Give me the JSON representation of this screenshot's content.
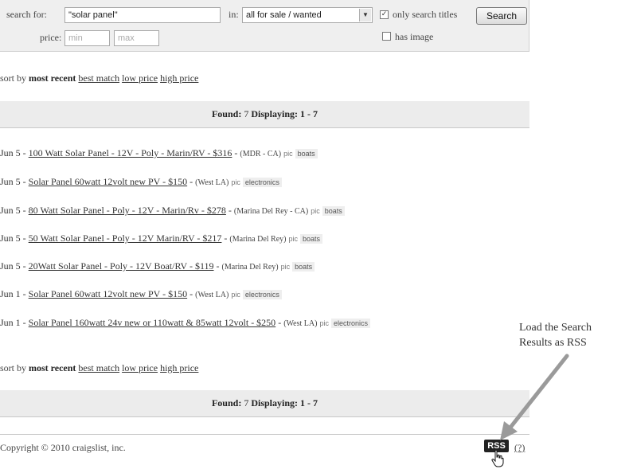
{
  "search": {
    "label": "search for:",
    "query": "\"solar panel\"",
    "in_label": "in:",
    "category": "all for sale / wanted",
    "only_titles_label": "only search titles",
    "only_titles_checked": true,
    "button_label": "Search",
    "price_label": "price:",
    "min_placeholder": "min",
    "max_placeholder": "max",
    "has_image_label": "has image",
    "has_image_checked": false
  },
  "sort": {
    "prefix": "sort by",
    "active": "most recent",
    "options": [
      "best match",
      "low price",
      "high price"
    ]
  },
  "found": {
    "label": "Found:",
    "count": "7",
    "displaying_label": "Displaying:",
    "range": "1 - 7"
  },
  "listings": [
    {
      "date": "Jun 5",
      "title": "100 Watt Solar Panel - 12V - Poly - Marin/RV - $316",
      "location": "(MDR - CA)",
      "pic": "pic",
      "category": "boats"
    },
    {
      "date": "Jun 5",
      "title": "Solar Panel 60watt 12volt new PV - $150",
      "location": "(West LA)",
      "pic": "pic",
      "category": "electronics"
    },
    {
      "date": "Jun 5",
      "title": "80 Watt Solar Panel - Poly - 12V - Marin/Rv - $278",
      "location": "(Marina Del Rey - CA)",
      "pic": "pic",
      "category": "boats"
    },
    {
      "date": "Jun 5",
      "title": "50 Watt Solar Panel - Poly - 12V Marin/RV - $217",
      "location": "(Marina Del Rey)",
      "pic": "pic",
      "category": "boats"
    },
    {
      "date": "Jun 5",
      "title": "20Watt Solar Panel - Poly - 12V Boat/RV - $119",
      "location": "(Marina Del Rey)",
      "pic": "pic",
      "category": "boats"
    },
    {
      "date": "Jun 1",
      "title": "Solar Panel 60watt 12volt new PV - $150",
      "location": "(West LA)",
      "pic": "pic",
      "category": "electronics"
    },
    {
      "date": "Jun 1",
      "title": "Solar Panel 160watt 24v new or 110watt & 85watt 12volt - $250",
      "location": "(West LA)",
      "pic": "pic",
      "category": "electronics"
    }
  ],
  "footer": {
    "copyright": "Copyright © 2010 craigslist, inc.",
    "rss_label": "RSS",
    "help_label": "(?)"
  },
  "annotation": {
    "line1": "Load the Search",
    "line2": "Results as RSS"
  },
  "colors": {
    "panel_bg": "#efefef",
    "bar_bg": "#ececec",
    "rss_bg": "#222222",
    "arrow": "#999999"
  },
  "icons": {
    "cursor": "hand-pointer-icon",
    "select_arrow": "chevron-down-icon"
  }
}
